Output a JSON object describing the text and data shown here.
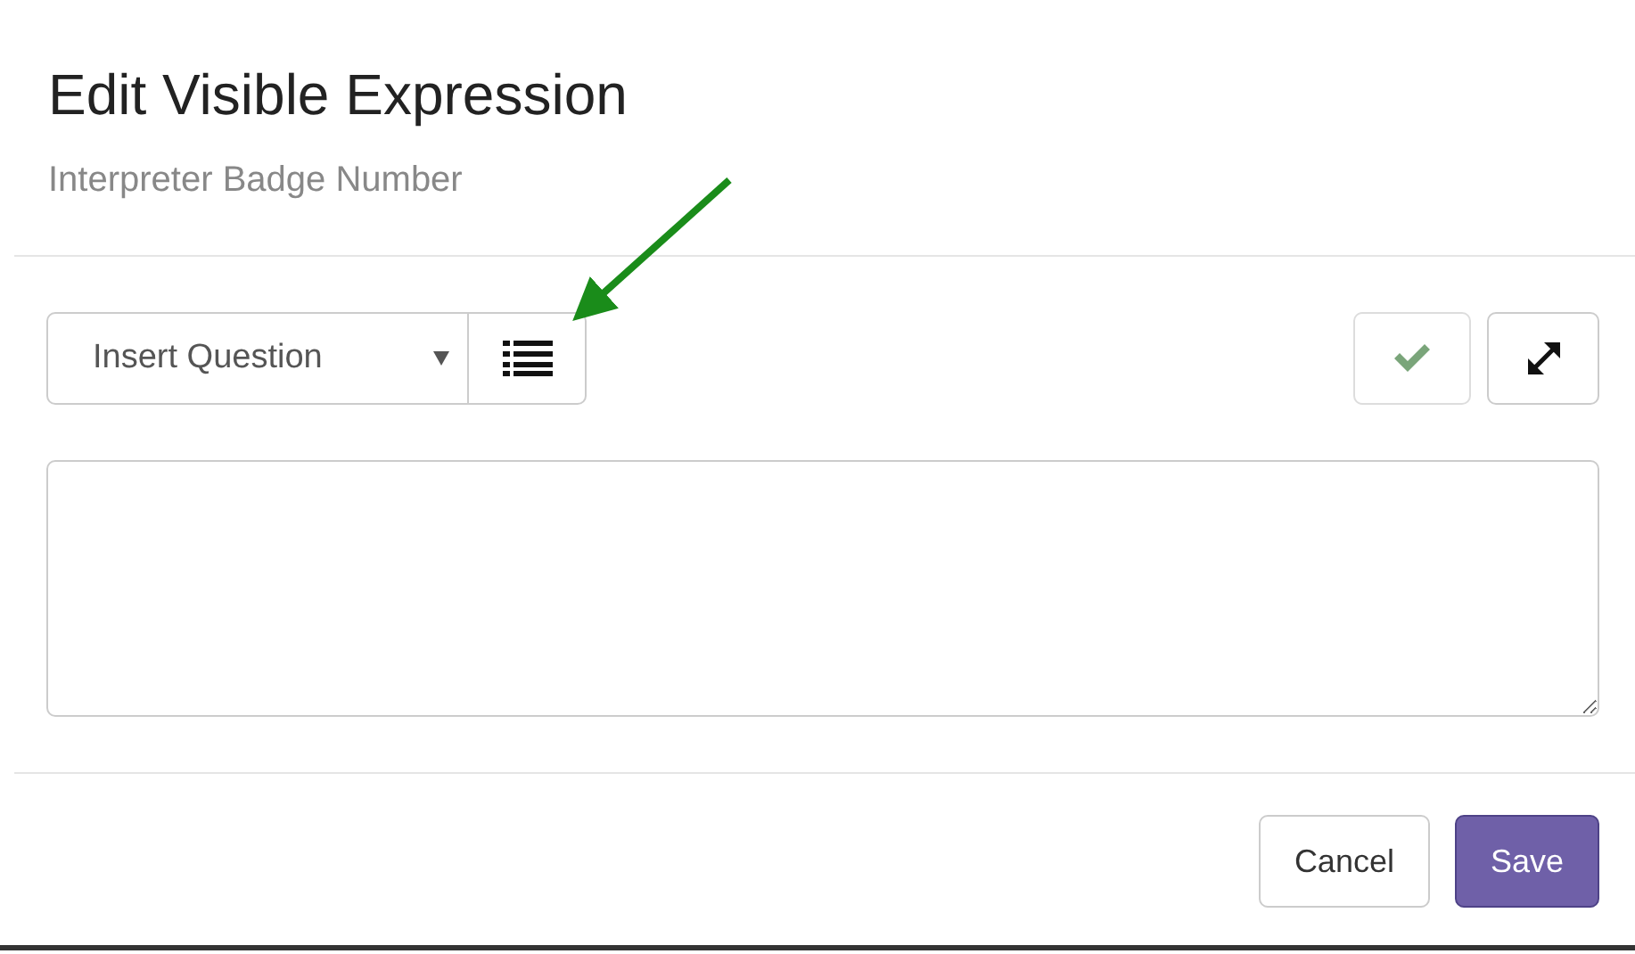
{
  "dialog": {
    "title": "Edit Visible Expression",
    "subtitle": "Interpreter Badge Number"
  },
  "toolbar": {
    "question_select": {
      "label": "Insert Question"
    }
  },
  "buttons": [
    {
      "label": "Cancel",
      "kind": "default"
    },
    {
      "label": "Save",
      "kind": "primary"
    }
  ]
}
